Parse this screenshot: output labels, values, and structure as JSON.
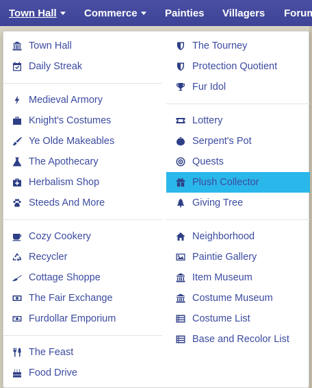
{
  "nav": {
    "items": [
      {
        "label": "Town Hall",
        "caret": true
      },
      {
        "label": "Commerce",
        "caret": true
      },
      {
        "label": "Painties"
      },
      {
        "label": "Villagers"
      },
      {
        "label": "Forum"
      }
    ]
  },
  "menu": {
    "left": [
      {
        "label": "Town Hall",
        "icon": "bank-icon"
      },
      {
        "label": "Daily Streak",
        "icon": "calendar-check-icon"
      },
      {
        "label": "Medieval Armory",
        "icon": "bolt-icon"
      },
      {
        "label": "Knight's Costumes",
        "icon": "suitcase-icon"
      },
      {
        "label": "Ye Olde Makeables",
        "icon": "paintbrush-icon"
      },
      {
        "label": "The Apothecary",
        "icon": "flask-icon"
      },
      {
        "label": "Herbalism Shop",
        "icon": "medkit-icon"
      },
      {
        "label": "Steeds And More",
        "icon": "paw-icon"
      },
      {
        "label": "Cozy Cookery",
        "icon": "coffee-icon"
      },
      {
        "label": "Recycler",
        "icon": "recycle-icon"
      },
      {
        "label": "Cottage Shoppe",
        "icon": "broom-icon"
      },
      {
        "label": "The Fair Exchange",
        "icon": "money-bill-icon"
      },
      {
        "label": "Furdollar Emporium",
        "icon": "money-icon"
      },
      {
        "label": "The Feast",
        "icon": "utensils-icon"
      },
      {
        "label": "Food Drive",
        "icon": "birthday-cake-icon"
      }
    ],
    "right": [
      {
        "label": "The Tourney",
        "icon": "shield-icon"
      },
      {
        "label": "Protection Quotient",
        "icon": "shield-icon"
      },
      {
        "label": "Fur Idol",
        "icon": "trophy-icon"
      },
      {
        "label": "Lottery",
        "icon": "ticket-icon"
      },
      {
        "label": "Serpent's Pot",
        "icon": "pot-icon"
      },
      {
        "label": "Quests",
        "icon": "bullseye-icon"
      },
      {
        "label": "Plush Collector",
        "icon": "gift-icon",
        "active": true
      },
      {
        "label": "Giving Tree",
        "icon": "tree-icon"
      },
      {
        "label": "Neighborhood",
        "icon": "home-icon"
      },
      {
        "label": "Paintie Gallery",
        "icon": "image-icon"
      },
      {
        "label": "Item Museum",
        "icon": "museum-icon"
      },
      {
        "label": "Costume Museum",
        "icon": "museum-icon"
      },
      {
        "label": "Costume List",
        "icon": "list-icon"
      },
      {
        "label": "Base and Recolor List",
        "icon": "list-icon"
      }
    ]
  },
  "colors": {
    "nav_bg": "#3d4396",
    "link": "#3c4ba0",
    "icon": "#2e3f86",
    "active_bg": "#2ab7ea"
  }
}
